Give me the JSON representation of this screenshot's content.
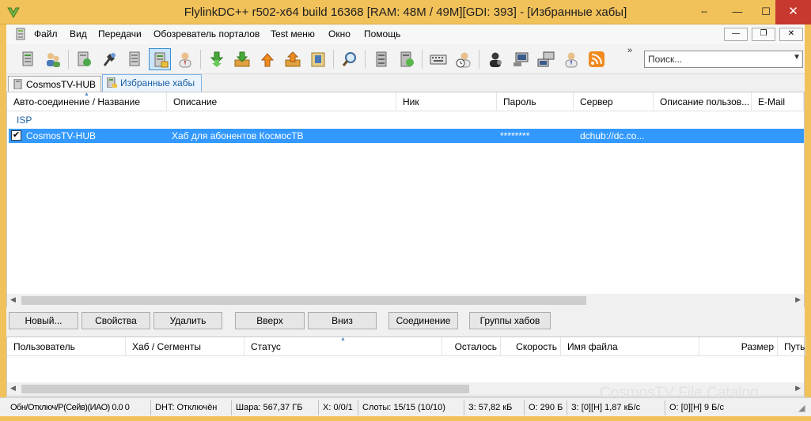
{
  "window": {
    "title": "FlylinkDC++ r502-x64 build 16368 [RAM: 48M / 49M][GDI: 393] - [Избранные хабы]",
    "pin_glyph": "⇔",
    "min_glyph": "—",
    "max_glyph": "☐",
    "close_glyph": "✕",
    "frame_color": "#f2c25a",
    "close_color": "#c7382e"
  },
  "menu": {
    "items": [
      "Файл",
      "Вид",
      "Передачи",
      "Обозреватель порталов",
      "Test меню",
      "Окно",
      "Помощь"
    ],
    "mdi_min": "—",
    "mdi_restore": "❐",
    "mdi_close": "✕"
  },
  "toolbar": {
    "more_glyph": "»",
    "search_placeholder": "Поиск...",
    "dropdown_glyph": "▼",
    "icons": [
      "connect-hub-icon",
      "user-group-icon",
      "public-hubs-icon",
      "reconnect-icon",
      "favorite-hubs-list-icon",
      "favorite-hubs-icon",
      "favorite-users-icon",
      "download-queue-icon",
      "downloads-icon",
      "upload-icon",
      "uploads-finished-icon",
      "file-folder-icon",
      "search-icon",
      "hub-server-icon",
      "adl-search-icon",
      "keyboard-icon",
      "user-clock-icon",
      "network-stats-icon",
      "computer-icon",
      "computer-transfer-icon",
      "user-upload-icon",
      "rss-icon"
    ]
  },
  "tabs": [
    {
      "label": "CosmosTV-HUB"
    },
    {
      "label": "Избранные хабы"
    }
  ],
  "hubs": {
    "columns": [
      "Авто-соединение / Название",
      "Описание",
      "Ник",
      "Пароль",
      "Сервер",
      "Описание пользов...",
      "E-Mail"
    ],
    "group": "ISP",
    "rows": [
      {
        "checked": "✔",
        "name": "CosmosTV-HUB",
        "description": "Хаб для абонентов КосмосТВ",
        "nick": "",
        "password": "********",
        "server": "dchub://dc.co...",
        "user_description": "",
        "email": ""
      }
    ]
  },
  "buttons": {
    "new": "Новый...",
    "properties": "Свойства",
    "remove": "Удалить",
    "up": "Вверх",
    "down": "Вниз",
    "connect": "Соединение",
    "groups": "Группы хабов"
  },
  "transfers": {
    "columns": [
      "Пользователь",
      "Хаб / Сегменты",
      "Статус",
      "Осталось",
      "Скорость",
      "Имя файла",
      "Размер",
      "Путь"
    ]
  },
  "watermark": "CosmosTV File Catalog",
  "status": {
    "overlap": "Обн/Отключ/Р(Сейв)(ИАО) 0.0 0",
    "dht": "DHT: Отключён",
    "share": "Шара: 567,37 ГБ",
    "hubs": "Х: 0/0/1",
    "slots": "Слоты: 15/15 (10/10)",
    "downloaded": "З: 57,82 кБ",
    "uploaded": "О: 290 Б",
    "down_speed": "З: [0][Н] 1,87 кБ/с",
    "up_speed": "О: [0][Н] 9 Б/с"
  }
}
